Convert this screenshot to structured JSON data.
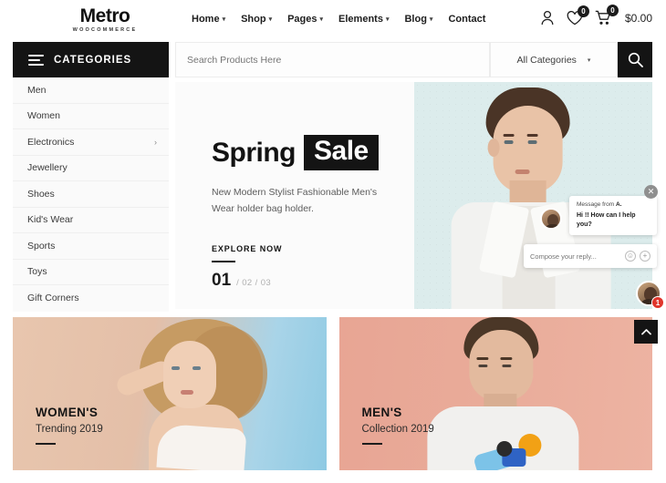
{
  "header": {
    "logo_main": "Metro",
    "logo_sub": "WOOCOMMERCE",
    "nav": [
      {
        "label": "Home",
        "has_caret": true
      },
      {
        "label": "Shop",
        "has_caret": true
      },
      {
        "label": "Pages",
        "has_caret": true
      },
      {
        "label": "Elements",
        "has_caret": true
      },
      {
        "label": "Blog",
        "has_caret": true
      },
      {
        "label": "Contact",
        "has_caret": false
      }
    ],
    "account_icon": "user-icon",
    "wishlist_icon": "heart-icon",
    "wishlist_count": "0",
    "cart_icon": "cart-icon",
    "cart_count": "0",
    "cart_total": "$0.00"
  },
  "search": {
    "placeholder": "Search Products Here",
    "value": "",
    "category_selected": "All Categories",
    "search_icon": "search-icon"
  },
  "sidebar": {
    "header_label": "CATEGORIES",
    "menu_icon": "hamburger-icon",
    "items": [
      {
        "label": "Men",
        "has_submenu": false
      },
      {
        "label": "Women",
        "has_submenu": false
      },
      {
        "label": "Electronics",
        "has_submenu": true
      },
      {
        "label": "Jewellery",
        "has_submenu": false
      },
      {
        "label": "Shoes",
        "has_submenu": false
      },
      {
        "label": "Kid's Wear",
        "has_submenu": false
      },
      {
        "label": "Sports",
        "has_submenu": false
      },
      {
        "label": "Toys",
        "has_submenu": false
      },
      {
        "label": "Gift Corners",
        "has_submenu": false
      }
    ],
    "submenu_arrow": "›"
  },
  "hero": {
    "title_plain": "Spring",
    "title_highlight": "Sale",
    "subtitle": "New Modern Stylist Fashionable Men's Wear holder bag holder.",
    "cta_label": "EXPLORE NOW",
    "pager_active": "01",
    "pager_rest": "/ 02  / 03",
    "background_color": "#dcecec"
  },
  "promos": [
    {
      "title": "WOMEN'S",
      "subtitle": "Trending 2019",
      "accent_color": "#e8c6ae"
    },
    {
      "title": "MEN'S",
      "subtitle": "Collection 2019",
      "accent_color": "#e8a594"
    }
  ],
  "chat": {
    "close_icon": "close-icon",
    "from_prefix": "Message from ",
    "from_name": "A.",
    "message": "Hi !! How can I help you?",
    "reply_placeholder": "Compose your reply...",
    "emoji_icon": "emoji-icon",
    "emoji_glyph": "☺",
    "attach_icon": "plus-icon",
    "attach_glyph": "+",
    "unread_count": "1",
    "avatar": "agent-avatar"
  },
  "scroll_top": {
    "icon": "chevron-up-icon"
  }
}
